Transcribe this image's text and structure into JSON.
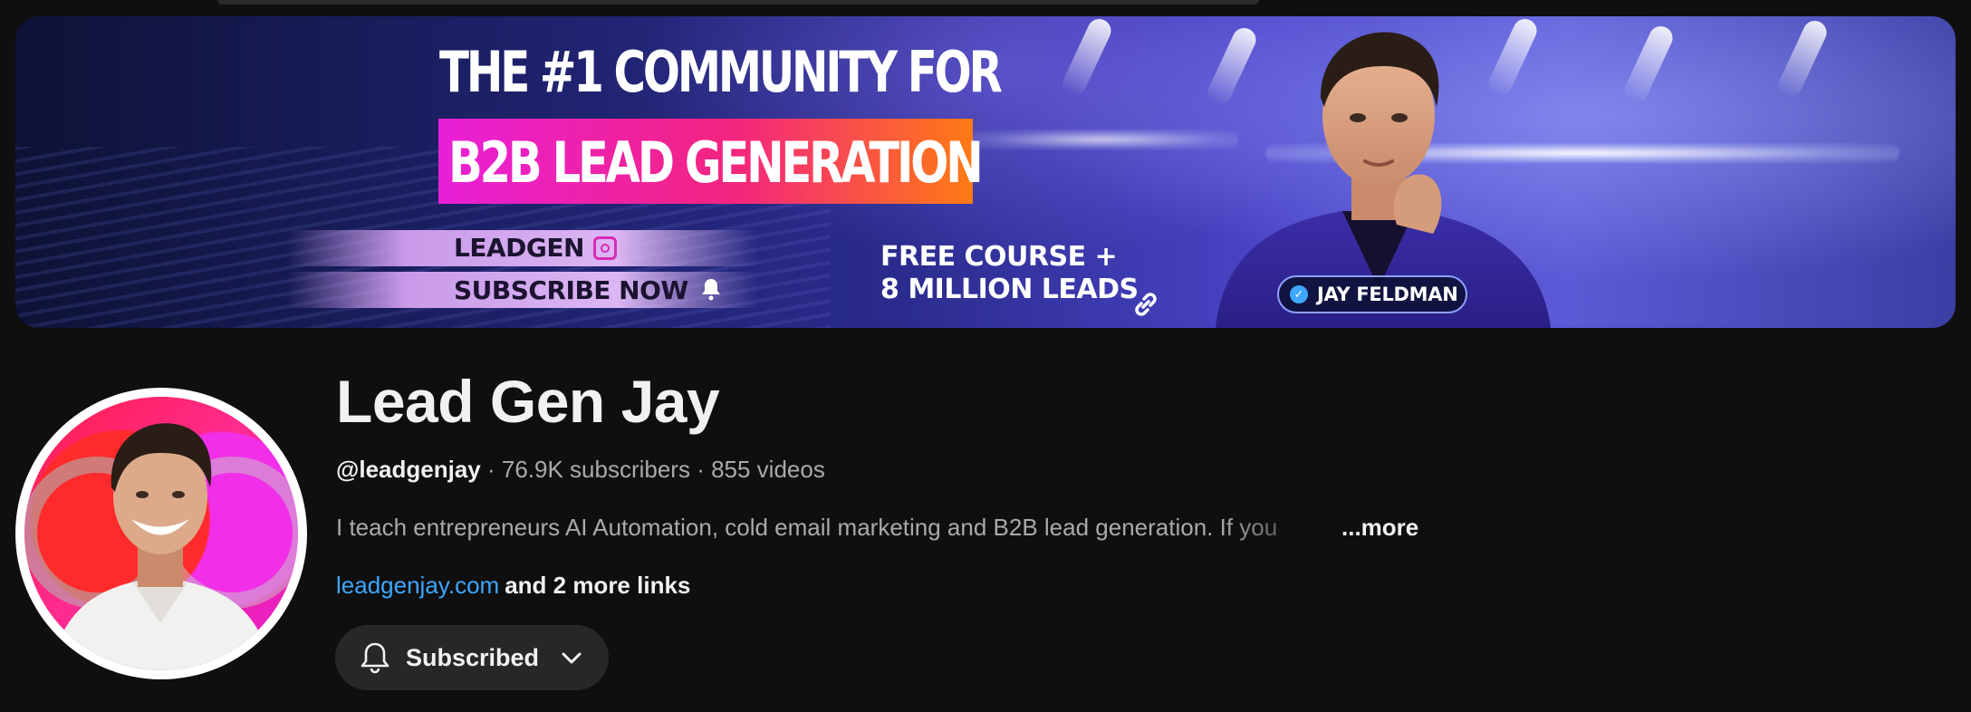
{
  "banner": {
    "headline_line1": "THE #1 COMMUNITY FOR",
    "headline_line2": "B2B LEAD GENERATION",
    "social_handle": "LEADGEN",
    "subscribe_cta": "SUBSCRIBE NOW",
    "offer_line1": "FREE COURSE +",
    "offer_line2": "8 MILLION LEADS",
    "name_chip": "JAY FELDMAN"
  },
  "channel": {
    "name": "Lead Gen Jay",
    "handle": "@leadgenjay",
    "subscribers": "76.9K subscribers",
    "videos": "855 videos",
    "separator": " · ",
    "description": "I teach entrepreneurs AI Automation, cold email marketing and B2B lead generation. If you",
    "more_label": "...more",
    "link_text": "leadgenjay.com",
    "more_links": "and 2 more links"
  },
  "subscribe_button": {
    "label": "Subscribed",
    "icon": "bell-icon",
    "dropdown_icon": "chevron-down-icon"
  },
  "colors": {
    "background": "#0f0f0f",
    "link": "#3ea6ff",
    "secondary_text": "#aaaaaa",
    "button_bg": "#272727",
    "brand_gradient": [
      "#e81fd8",
      "#ff7b14"
    ]
  }
}
